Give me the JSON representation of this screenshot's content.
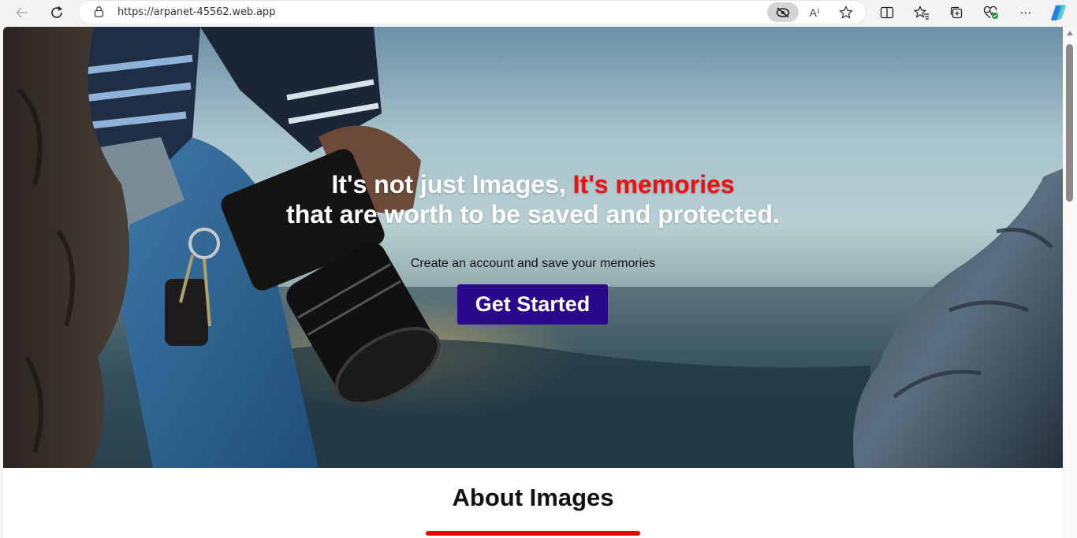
{
  "browser": {
    "url": "https://arpanet-45562.web.app",
    "icons": [
      "back-icon",
      "reload-icon",
      "lock-icon",
      "tracking-prevention-icon",
      "read-aloud-icon",
      "favorite-star-icon",
      "split-screen-icon",
      "favorites-icon",
      "collections-icon",
      "browser-essentials-icon",
      "more-icon",
      "copilot-icon"
    ],
    "read_aloud_glyph": "A⁾",
    "more_glyph": "⋯"
  },
  "hero": {
    "title_part1": "It's not just Images, ",
    "title_accent": "It's memories",
    "title_line2": "that are worth to be saved and protected.",
    "subtitle": "Create an account and save your memories",
    "cta_label": "Get Started"
  },
  "about": {
    "title": "About Images"
  },
  "colors": {
    "accent_red": "#ee1111",
    "cta_bg": "#2a0a8a",
    "underline_red": "#ee0000"
  }
}
